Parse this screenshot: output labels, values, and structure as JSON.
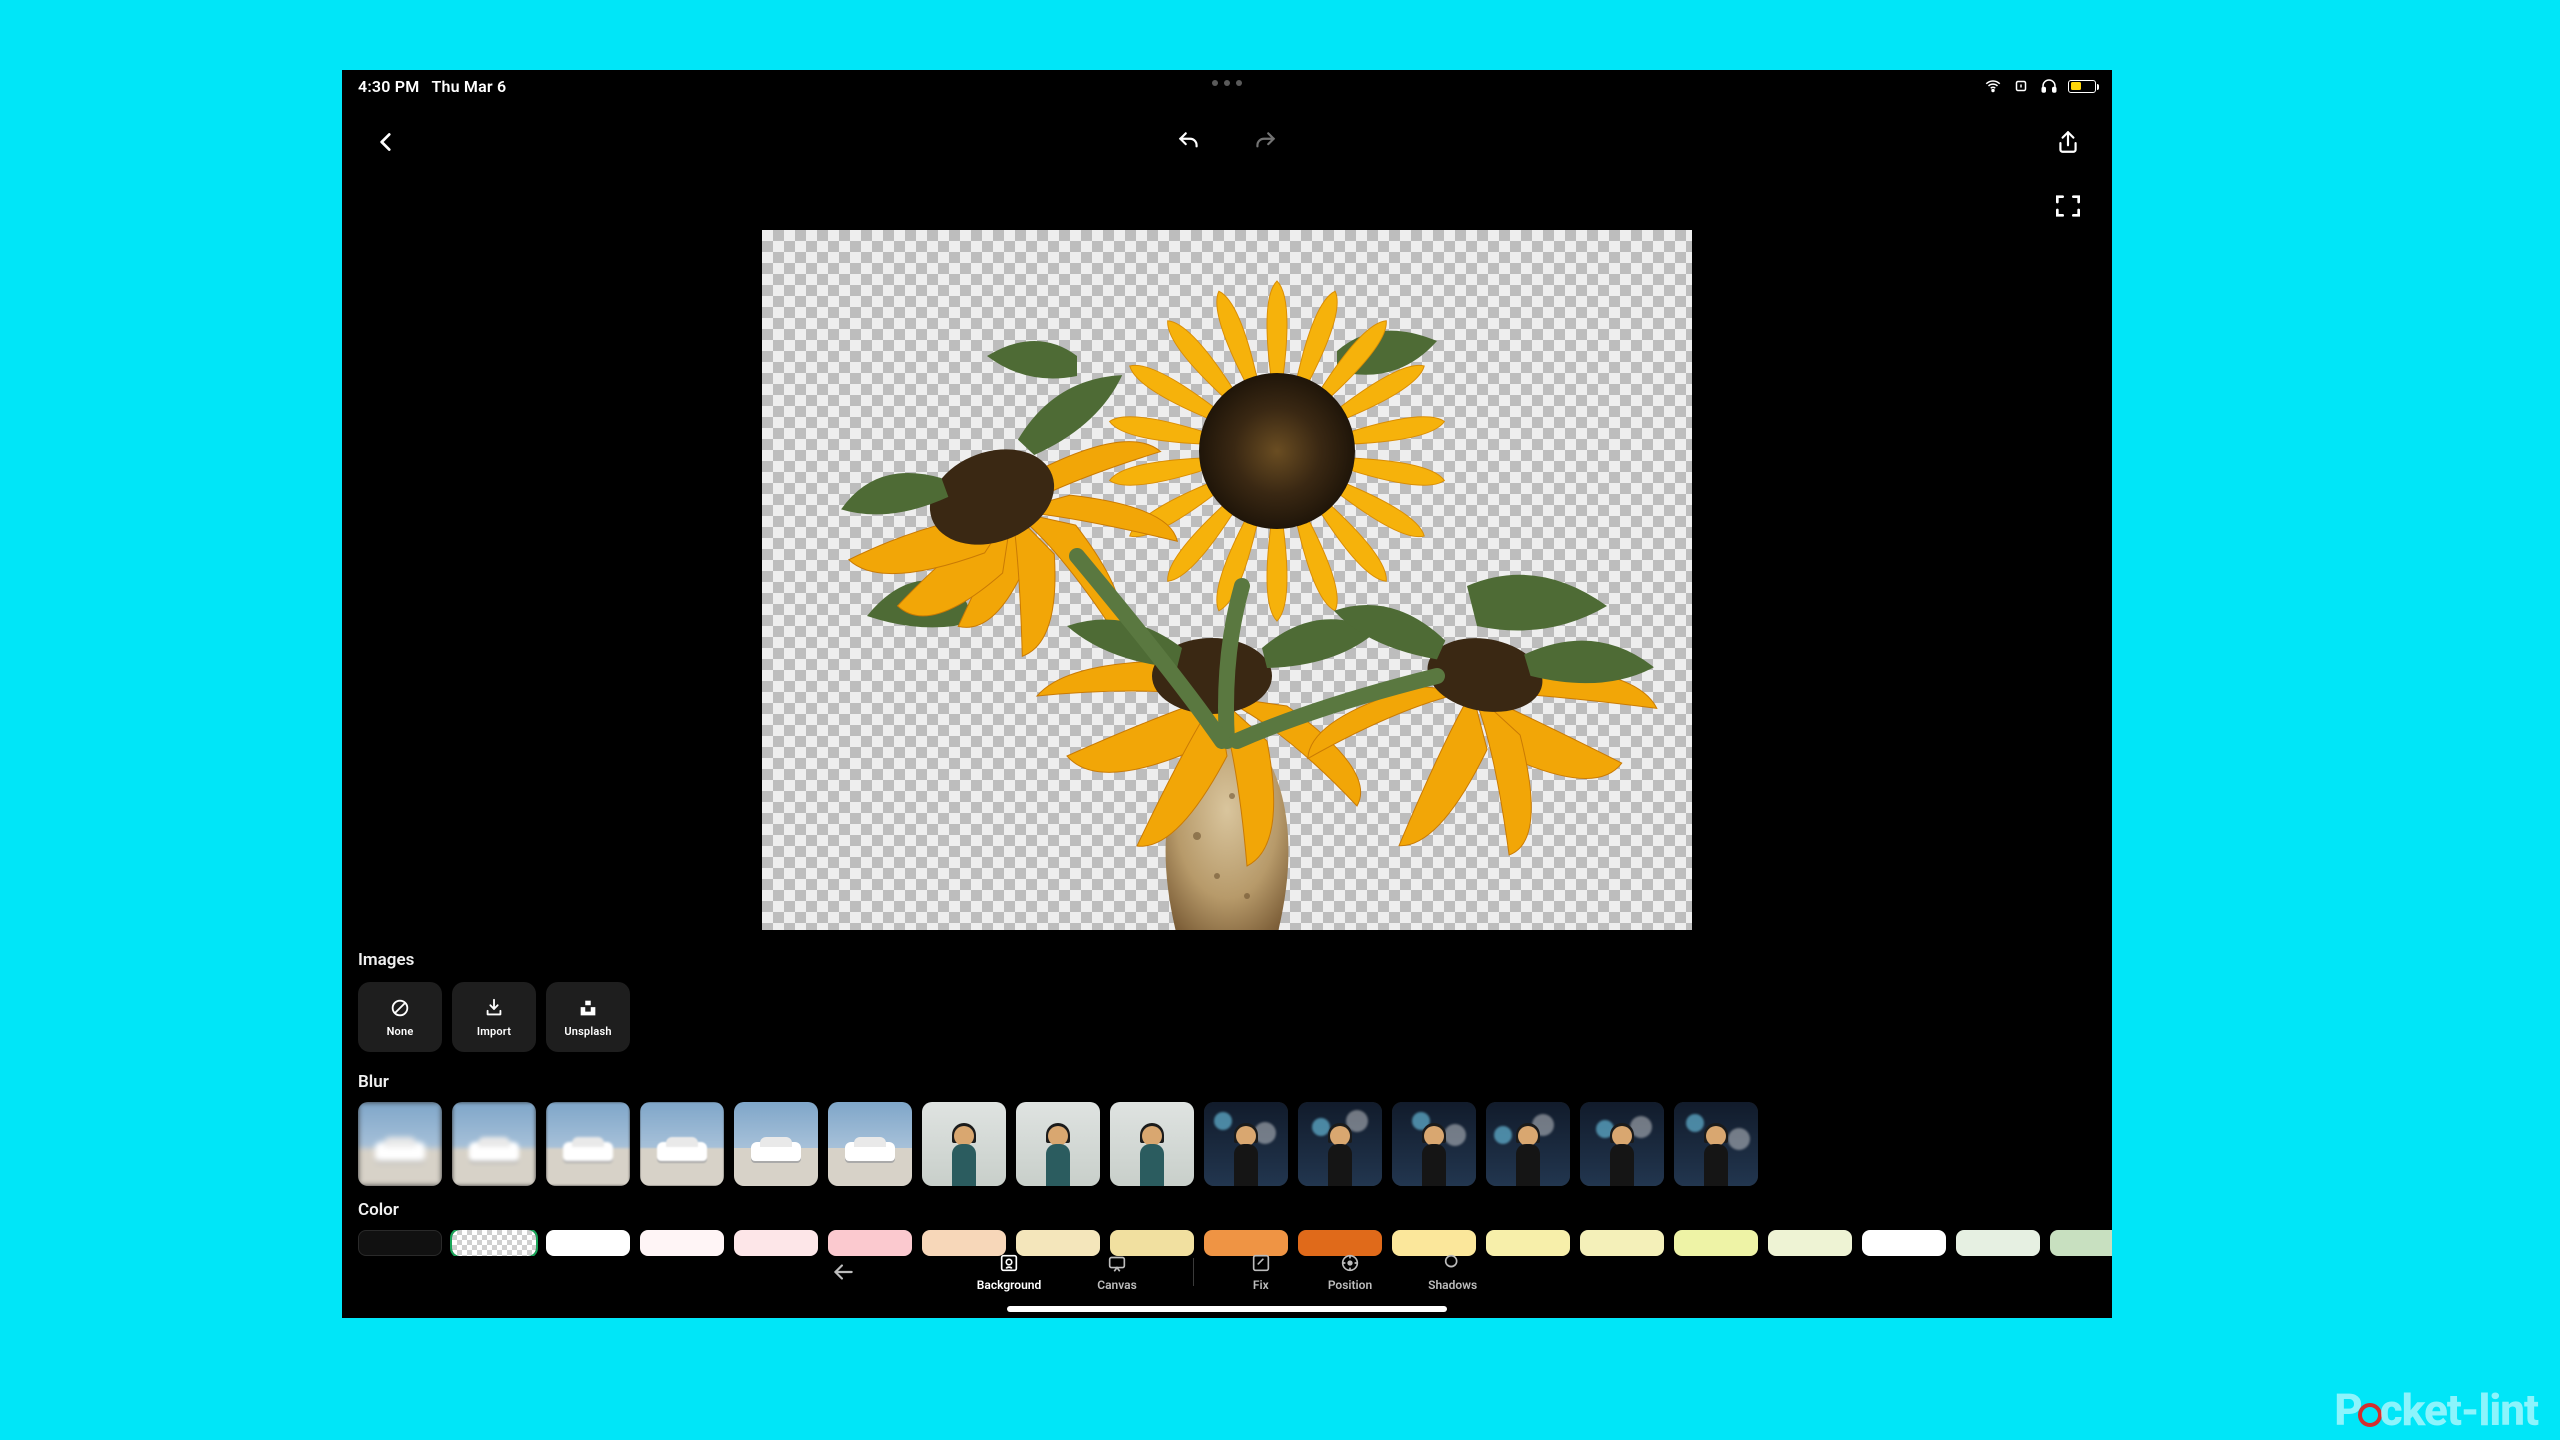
{
  "status": {
    "time": "4:30 PM",
    "date": "Thu Mar 6"
  },
  "sections": {
    "images_label": "Images",
    "blur_label": "Blur",
    "color_label": "Color"
  },
  "images_buttons": {
    "none": "None",
    "import": "Import",
    "unsplash": "Unsplash"
  },
  "bottom": {
    "background": "Background",
    "canvas": "Canvas",
    "fix": "Fix",
    "position": "Position",
    "shadows": "Shadows"
  },
  "color_swatches": [
    "#111111",
    "checker",
    "#ffffff",
    "#fff5f6",
    "#fde6e8",
    "#fbc9cf",
    "#f7d7b9",
    "#f4e6bb",
    "#f1e0a0",
    "#ef9444",
    "#e06a1a",
    "#fbe79b",
    "#f7efaa",
    "#f4f0b9",
    "#eef3a6",
    "#eef3d4",
    "#ffffff",
    "#e6f0e2",
    "#c8e0c0"
  ],
  "selected_swatch_index": 1,
  "watermark": "Pocket-lint"
}
